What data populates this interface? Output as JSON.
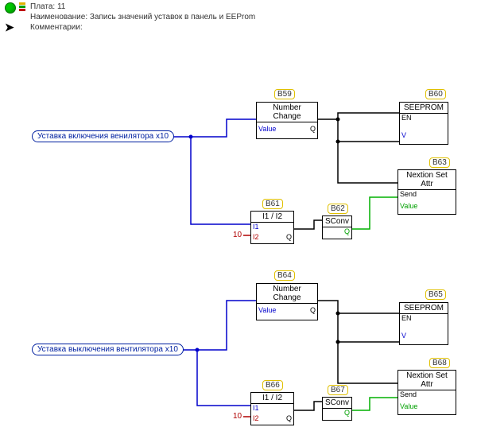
{
  "header": {
    "plate": "Плата: 11",
    "name": "Наименование: Запись значений  уставок в панель и EEProm",
    "comments": "Комментарии:"
  },
  "inputs": {
    "fan_on": "Уставка включения венилятора x10",
    "fan_off": "Уставка выключения вентилятора x10"
  },
  "constants": {
    "k10a": "10",
    "k10b": "10"
  },
  "blocks": {
    "b59": {
      "tag": "B59",
      "title": "Number Change",
      "in": "Value",
      "out": "Q"
    },
    "b60": {
      "tag": "B60",
      "title": "SEEPROM",
      "p1": "EN",
      "p2": "V"
    },
    "b61": {
      "tag": "B61",
      "title": "I1 / I2",
      "i1": "I1",
      "i2": "I2",
      "out": "Q"
    },
    "b62": {
      "tag": "B62",
      "title": "SСonv",
      "out": "Q"
    },
    "b63": {
      "tag": "B63",
      "title": "Nextion Set Attr",
      "p1": "Send",
      "p2": "Value"
    },
    "b64": {
      "tag": "B64",
      "title": "Number Change",
      "in": "Value",
      "out": "Q"
    },
    "b65": {
      "tag": "B65",
      "title": "SEEPROM",
      "p1": "EN",
      "p2": "V"
    },
    "b66": {
      "tag": "B66",
      "title": "I1 / I2",
      "i1": "I1",
      "i2": "I2",
      "out": "Q"
    },
    "b67": {
      "tag": "B67",
      "title": "SСonv",
      "out": "Q"
    },
    "b68": {
      "tag": "B68",
      "title": "Nextion Set Attr",
      "p1": "Send",
      "p2": "Value"
    }
  }
}
